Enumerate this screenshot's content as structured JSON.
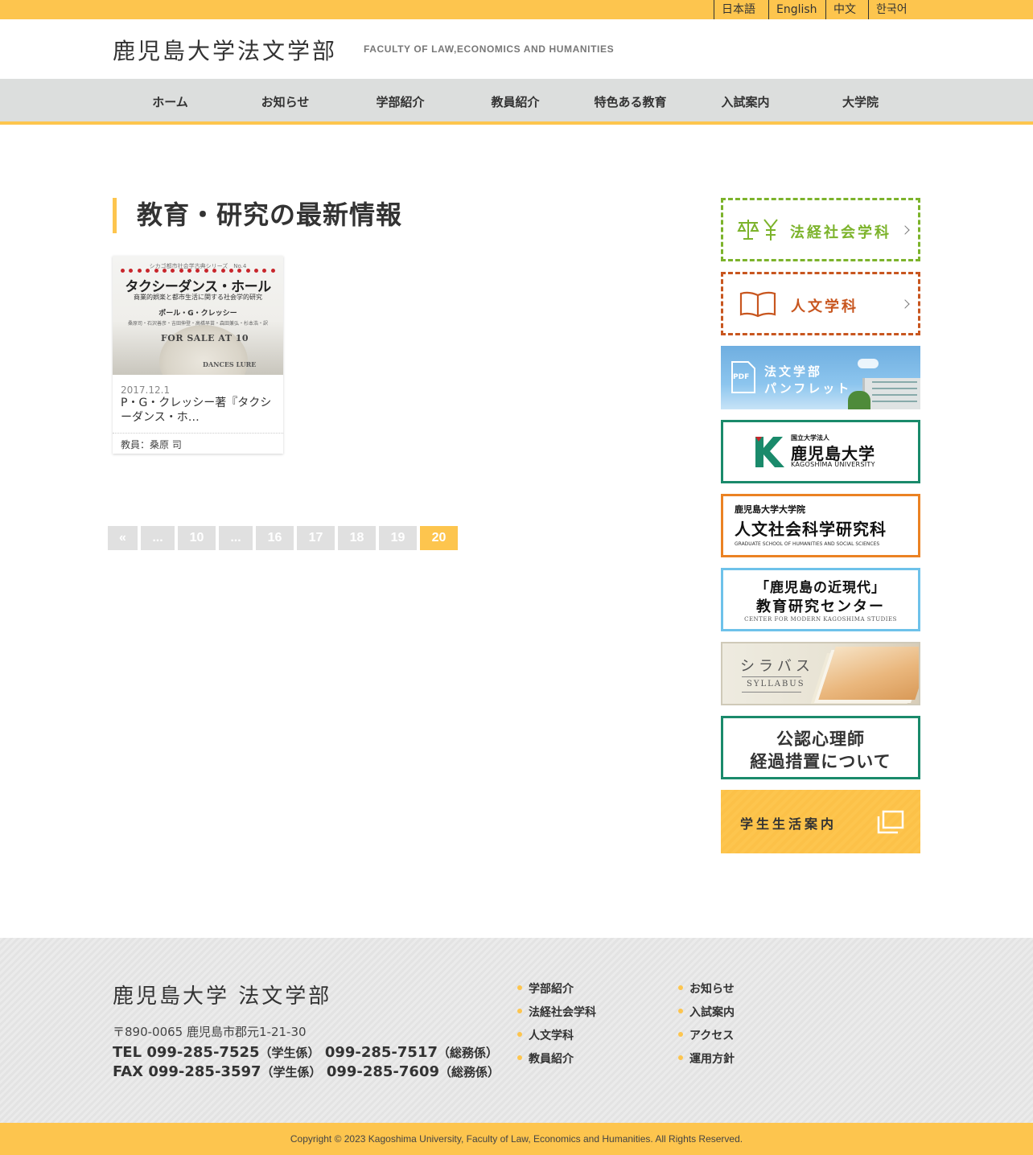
{
  "header": {
    "languages": [
      "日本語",
      "English",
      "中文",
      "한국어"
    ],
    "logo_jp": "鹿児島大学法文学部",
    "logo_en": "FACULTY OF LAW,ECONOMICS AND HUMANITIES"
  },
  "nav": [
    "ホーム",
    "お知らせ",
    "学部紹介",
    "教員紹介",
    "特色ある教育",
    "入試案内",
    "大学院"
  ],
  "main": {
    "title": "教育・研究の最新情報",
    "cards": [
      {
        "date": "2017.12.1",
        "text": "P・G・クレッシー著『タクシーダンス・ホ…",
        "author": "教員：桑原 司",
        "cover": {
          "series": "シカゴ都市社会学古典シリーズ　No.4",
          "title": "タクシーダンス・ホール",
          "subtitle": "商業的娯楽と都市生活に関する社会学的研究",
          "author": "ポール・G・クレッシー",
          "translators": "桑原司・石沢善彦・吉田伸登・高橋早苗・森田兼弘・杉本浩・訳",
          "paper1": "FOR SALE AT 10",
          "paper2": "DANCES LURE"
        }
      }
    ],
    "pagination": [
      "«",
      "...",
      "10",
      "...",
      "16",
      "17",
      "18",
      "19",
      "20"
    ],
    "current_page": "20"
  },
  "sidebar": {
    "hokei": "法経社会学科",
    "jinbun": "人文学科",
    "pamphlet": {
      "icon": "PDF",
      "line1": "法文学部",
      "line2": "パンフレット"
    },
    "university": {
      "small": "国立大学法人",
      "name": "鹿児島大学",
      "en": "KAGOSHIMA UNIVERSITY"
    },
    "graduate": {
      "small": "鹿児島大学大学院",
      "name": "人文社会科学研究科",
      "en": "GRADUATE SCHOOL OF HUMANITIES AND SOCIAL SCIENCES"
    },
    "center": {
      "line1": "「鹿児島の近現代」",
      "line2": "教育研究センター",
      "en": "CENTER FOR MODERN KAGOSHIMA STUDIES"
    },
    "syllabus": {
      "jp": "シラバス",
      "en": "SYLLABUS"
    },
    "koninshinrishi": {
      "line1": "公認心理師",
      "line2": "経過措置について"
    },
    "student_life": "学生生活案内"
  },
  "footer": {
    "logo": "鹿児島大学 法文学部",
    "address": "〒890-0065 鹿児島市郡元1-21-30",
    "tel_label": "TEL",
    "tel1": "099-285-7525",
    "tel1_note": "（学生係）",
    "tel2": "099-285-7517",
    "tel2_note": "（総務係）",
    "fax_label": "FAX",
    "fax1": "099-285-3597",
    "fax1_note": "（学生係）",
    "fax2": "099-285-7609",
    "fax2_note": "（総務係）",
    "links_col1": [
      "学部紹介",
      "法経社会学科",
      "人文学科",
      "教員紹介"
    ],
    "links_col2": [
      "お知らせ",
      "入試案内",
      "アクセス",
      "運用方針"
    ],
    "copyright": "Copyright © 2023 Kagoshima University, Faculty of Law, Economics and Humanities. All Rights Reserved."
  },
  "colors": {
    "accent": "#fdc54e",
    "nav_bg": "#dcdedd",
    "hokei": "#7cb32b",
    "jinbun": "#c8561f",
    "univ_green": "#1a8a6b",
    "grad_orange": "#eb8223",
    "center_blue": "#6ec2ea"
  }
}
